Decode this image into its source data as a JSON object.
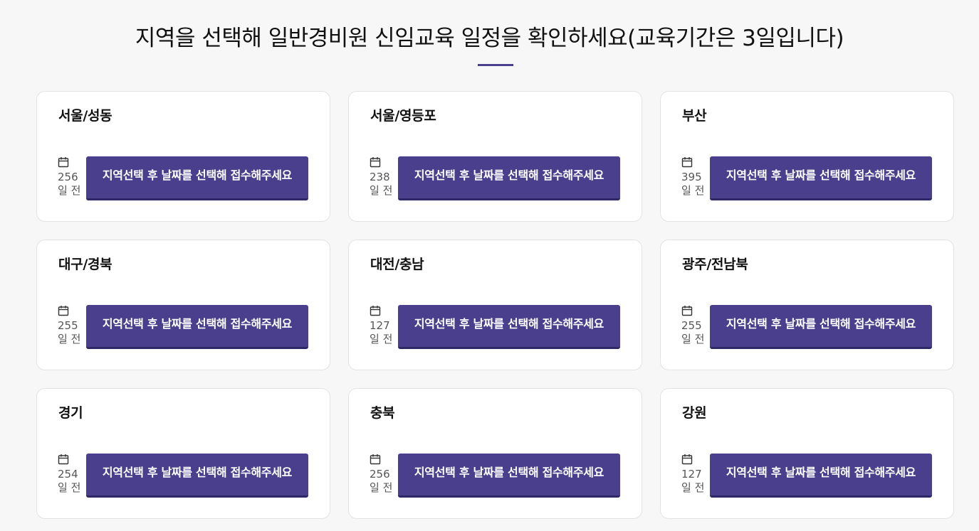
{
  "header": {
    "title": "지역을 선택해 일반경비원 신임교육 일정을 확인하세요(교육기간은 3일입니다)"
  },
  "colors": {
    "accent": "#4a3f8c",
    "background": "#f7f7f7",
    "card": "#ffffff"
  },
  "button_label": "지역선택 후 날짜를 선택해 접수해주세요",
  "dday_unit": "일 전",
  "icons": {
    "calendar": "calendar-icon"
  },
  "regions": [
    {
      "name": "서울/성동",
      "days": "256"
    },
    {
      "name": "서울/영등포",
      "days": "238"
    },
    {
      "name": "부산",
      "days": "395"
    },
    {
      "name": "대구/경북",
      "days": "255"
    },
    {
      "name": "대전/충남",
      "days": "127"
    },
    {
      "name": "광주/전남북",
      "days": "255"
    },
    {
      "name": "경기",
      "days": "254"
    },
    {
      "name": "충북",
      "days": "256"
    },
    {
      "name": "강원",
      "days": "127"
    }
  ]
}
